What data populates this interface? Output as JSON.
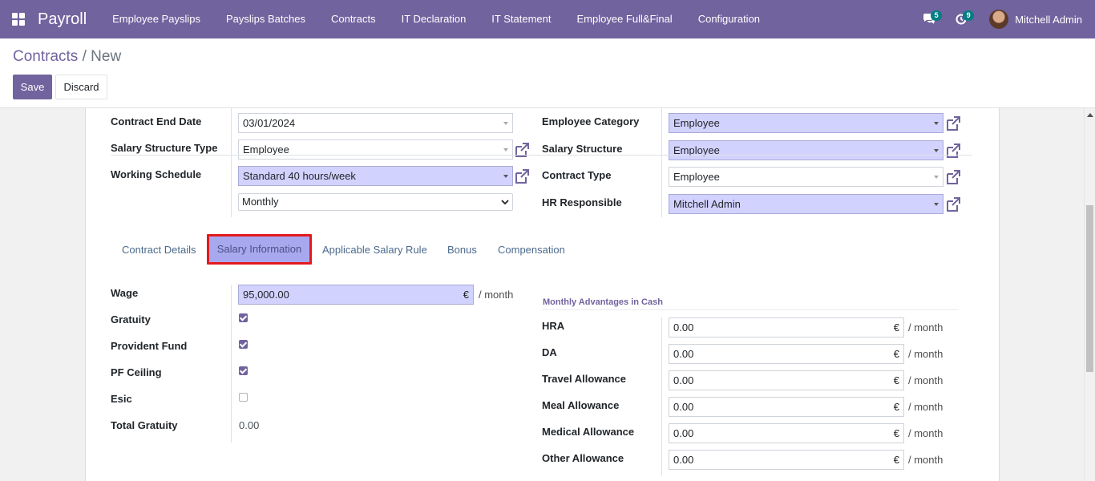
{
  "navbar": {
    "app_name": "Payroll",
    "menu": [
      "Employee Payslips",
      "Payslips Batches",
      "Contracts",
      "IT Declaration",
      "IT Statement",
      "Employee Full&Final",
      "Configuration"
    ],
    "messages_count": "5",
    "activities_count": "9",
    "user_name": "Mitchell Admin"
  },
  "breadcrumb": {
    "parent": "Contracts",
    "separator": "/",
    "current": "New"
  },
  "buttons": {
    "save": "Save",
    "discard": "Discard"
  },
  "form_top": {
    "contract_end_date_label": "Contract End Date",
    "contract_end_date": "03/01/2024",
    "salary_structure_type_label": "Salary Structure Type",
    "salary_structure_type": "Employee",
    "working_schedule_label": "Working Schedule",
    "working_schedule": "Standard 40 hours/week",
    "schedule_pay": "Monthly",
    "employee_category_label": "Employee Category",
    "employee_category": "Employee",
    "salary_structure_label": "Salary Structure",
    "salary_structure": "Employee",
    "contract_type_label": "Contract Type",
    "contract_type": "Employee",
    "hr_responsible_label": "HR Responsible",
    "hr_responsible": "Mitchell Admin"
  },
  "tabs": [
    "Contract Details",
    "Salary Information",
    "Applicable Salary Rule",
    "Bonus",
    "Compensation"
  ],
  "active_tab": "Salary Information",
  "salary": {
    "wage_label": "Wage",
    "wage": "95,000.00",
    "currency": "€",
    "per_month": "/ month",
    "gratuity_label": "Gratuity",
    "gratuity": true,
    "provident_fund_label": "Provident Fund",
    "provident_fund": true,
    "pf_ceiling_label": "PF Ceiling",
    "pf_ceiling": true,
    "esic_label": "Esic",
    "esic": false,
    "total_gratuity_label": "Total Gratuity",
    "total_gratuity": "0.00"
  },
  "advantages": {
    "title": "Monthly Advantages in Cash",
    "items": [
      {
        "label": "HRA",
        "value": "0.00"
      },
      {
        "label": "DA",
        "value": "0.00"
      },
      {
        "label": "Travel Allowance",
        "value": "0.00"
      },
      {
        "label": "Meal Allowance",
        "value": "0.00"
      },
      {
        "label": "Medical Allowance",
        "value": "0.00"
      },
      {
        "label": "Other Allowance",
        "value": "0.00"
      }
    ]
  },
  "colors": {
    "brand": "#71639e",
    "required_field": "#d2d2ff",
    "tab_highlight_border": "#e31a1c"
  }
}
